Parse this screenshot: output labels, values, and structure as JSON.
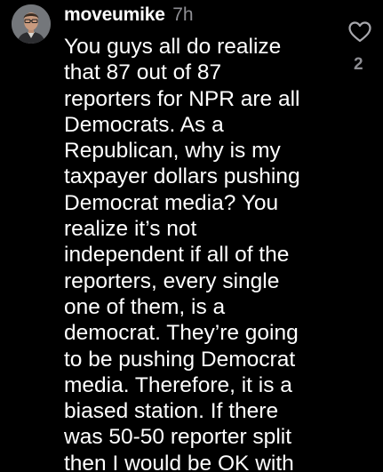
{
  "comment": {
    "username": "moveumike",
    "timestamp": "7h",
    "lines": [
      "You guys all do realize",
      "that 87 out of 87",
      "reporters for NPR are all",
      "Democrats. As a",
      "Republican, why is my",
      "taxpayer dollars pushing",
      "Democrat media? You",
      "realize it’s not",
      "independent if all of the",
      "reporters, every single",
      "one of them, is a",
      "democrat. They’re going",
      "to be pushing Democrat",
      "media. Therefore, it is a",
      "biased station. If there",
      "was 50-50 reporter split",
      "then I would be OK with"
    ],
    "like_icon": "heart-outline-icon",
    "like_count": "2"
  },
  "colors": {
    "background": "#000000",
    "text": "#ffffff",
    "secondary_text": "#8e8e93"
  }
}
